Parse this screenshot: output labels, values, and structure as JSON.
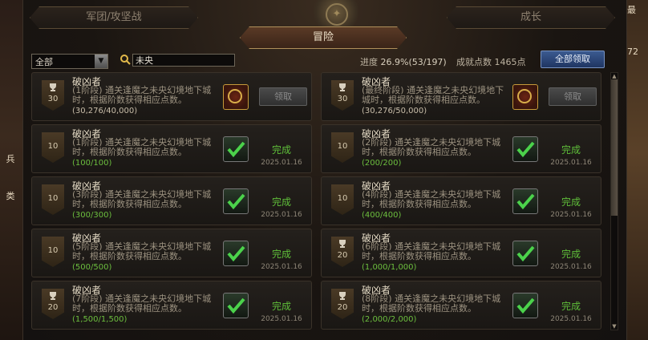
{
  "tabs": {
    "left": "军团/攻坚战",
    "right": "成长",
    "active": "冒险"
  },
  "filter": {
    "selected": "全部"
  },
  "search": {
    "value": "未央"
  },
  "stats": {
    "progress_label": "进度",
    "progress_value": "26.9%(53/197)",
    "points_label": "成就点数",
    "points_value": "1465点"
  },
  "claim_all_label": "全部领取",
  "edge": {
    "left": [
      "兵",
      "类"
    ],
    "right": [
      "最",
      "72"
    ]
  },
  "cards": [
    {
      "title": "破凶者",
      "desc": "(1阶段) 通关逢魔之未央幻境地下城时，根据阶数获得相应点数。",
      "progress": "(30,276/40,000)",
      "points": "30",
      "trophy": true,
      "status": "claim",
      "button": "领取",
      "date": ""
    },
    {
      "title": "破凶者",
      "desc": "(最终阶段) 通关逢魔之未央幻境地下城时，根据阶数获得相应点数。",
      "progress": "(30,276/50,000)",
      "points": "30",
      "trophy": true,
      "status": "claim",
      "button": "领取",
      "date": ""
    },
    {
      "title": "破凶者",
      "desc": "(1阶段) 通关逢魔之未央幻境地下城时，根据阶数获得相应点数。",
      "progress": "(100/100)",
      "points": "10",
      "trophy": false,
      "status": "done",
      "button": "完成",
      "date": "2025.01.16"
    },
    {
      "title": "破凶者",
      "desc": "(2阶段) 通关逢魔之未央幻境地下城时，根据阶数获得相应点数。",
      "progress": "(200/200)",
      "points": "10",
      "trophy": false,
      "status": "done",
      "button": "完成",
      "date": "2025.01.16"
    },
    {
      "title": "破凶者",
      "desc": "(3阶段) 通关逢魔之未央幻境地下城时，根据阶数获得相应点数。",
      "progress": "(300/300)",
      "points": "10",
      "trophy": false,
      "status": "done",
      "button": "完成",
      "date": "2025.01.16"
    },
    {
      "title": "破凶者",
      "desc": "(4阶段) 通关逢魔之未央幻境地下城时，根据阶数获得相应点数。",
      "progress": "(400/400)",
      "points": "10",
      "trophy": false,
      "status": "done",
      "button": "完成",
      "date": "2025.01.16"
    },
    {
      "title": "破凶者",
      "desc": "(5阶段) 通关逢魔之未央幻境地下城时，根据阶数获得相应点数。",
      "progress": "(500/500)",
      "points": "10",
      "trophy": false,
      "status": "done",
      "button": "完成",
      "date": "2025.01.16"
    },
    {
      "title": "破凶者",
      "desc": "(6阶段) 通关逢魔之未央幻境地下城时，根据阶数获得相应点数。",
      "progress": "(1,000/1,000)",
      "points": "20",
      "trophy": true,
      "status": "done",
      "button": "完成",
      "date": "2025.01.16"
    },
    {
      "title": "破凶者",
      "desc": "(7阶段) 通关逢魔之未央幻境地下城时，根据阶数获得相应点数。",
      "progress": "(1,500/1,500)",
      "points": "20",
      "trophy": true,
      "status": "done",
      "button": "完成",
      "date": "2025.01.16"
    },
    {
      "title": "破凶者",
      "desc": "(8阶段) 通关逢魔之未央幻境地下城时，根据阶数获得相应点数。",
      "progress": "(2,000/2,000)",
      "points": "20",
      "trophy": true,
      "status": "done",
      "button": "完成",
      "date": "2025.01.16"
    }
  ]
}
